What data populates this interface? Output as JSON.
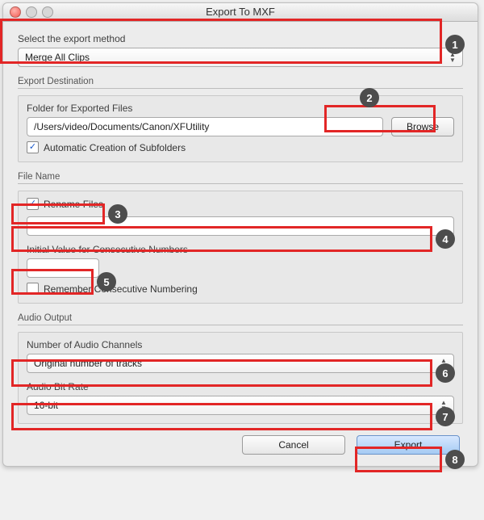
{
  "window": {
    "title": "Export To MXF"
  },
  "method": {
    "label": "Select the export method",
    "value": "Merge All Clips"
  },
  "destination": {
    "legend": "Export Destination",
    "folder_label": "Folder for Exported Files",
    "folder_value": "/Users/video/Documents/Canon/XFUtility",
    "browse_label": "Browse",
    "auto_subfolders_checked": true,
    "auto_subfolders_label": "Automatic Creation of Subfolders"
  },
  "filename": {
    "legend": "File Name",
    "rename_checked": true,
    "rename_label": "Rename Files",
    "name_value": "",
    "initial_label": "Initial Value for Consecutive Numbers",
    "initial_value": "",
    "remember_checked": false,
    "remember_label": "Remember Consecutive Numbering"
  },
  "audio": {
    "legend": "Audio Output",
    "channels_label": "Number of Audio Channels",
    "channels_value": "Original number of tracks",
    "bitrate_label": "Audio Bit Rate",
    "bitrate_value": "16-bit"
  },
  "buttons": {
    "cancel": "Cancel",
    "export": "Export"
  },
  "annotations": {
    "b1": "1",
    "b2": "2",
    "b3": "3",
    "b4": "4",
    "b5": "5",
    "b6": "6",
    "b7": "7",
    "b8": "8"
  }
}
